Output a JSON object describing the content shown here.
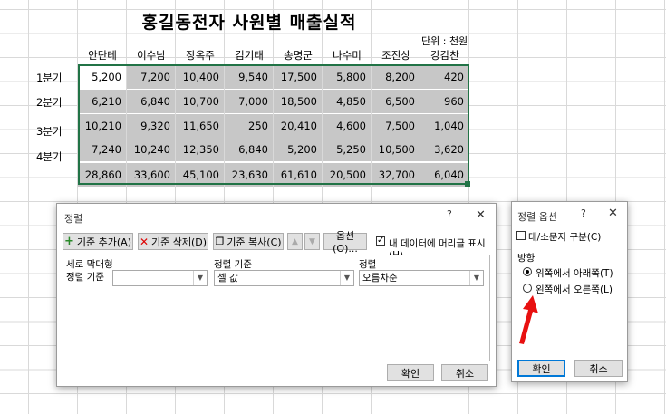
{
  "sheet": {
    "title": "홍길동전자 사원별 매출실적",
    "unit": "단위 : 천원",
    "columns": [
      "안단테",
      "이수남",
      "장옥주",
      "김기태",
      "송명군",
      "나수미",
      "조진상",
      "강감찬"
    ],
    "rows": [
      {
        "label": "1분기",
        "values": [
          "5,200",
          "7,200",
          "10,400",
          "9,540",
          "17,500",
          "5,800",
          "8,200",
          "420"
        ]
      },
      {
        "label": "2분기",
        "values": [
          "6,210",
          "6,840",
          "10,700",
          "7,000",
          "18,500",
          "4,850",
          "6,500",
          "960"
        ]
      },
      {
        "label": "3분기",
        "values": [
          "10,210",
          "9,320",
          "11,650",
          "250",
          "20,410",
          "4,600",
          "7,500",
          "1,040"
        ]
      },
      {
        "label": "4분기",
        "values": [
          "7,240",
          "10,240",
          "12,350",
          "6,840",
          "5,200",
          "5,250",
          "10,500",
          "3,620"
        ]
      },
      {
        "label": "",
        "values": [
          "28,860",
          "33,600",
          "45,100",
          "23,630",
          "61,610",
          "20,500",
          "32,700",
          "6,040"
        ]
      }
    ]
  },
  "sort_dialog": {
    "title": "정렬",
    "help": "?",
    "close": "✕",
    "add_level": "기준 추가(A)",
    "delete_level": "기준 삭제(D)",
    "copy_level": "기준 복사(C)",
    "options": "옵션(O)...",
    "header_checkbox": "내 데이터에 머리글 표시(H)",
    "header_col_label": "세로 막대형",
    "sort_on_label": "정렬 기준",
    "order_label": "정렬",
    "row_label": "정렬 기준",
    "column_value": "",
    "sort_on_value": "셀 값",
    "order_value": "오름차순",
    "ok": "확인",
    "cancel": "취소"
  },
  "options_dialog": {
    "title": "정렬 옵션",
    "help": "?",
    "close": "✕",
    "case_sensitive": "대/소문자 구분(C)",
    "orientation_label": "방향",
    "top_to_bottom": "위쪽에서 아래쪽(T)",
    "left_to_right": "왼쪽에서 오른쪽(L)",
    "ok": "확인",
    "cancel": "취소"
  },
  "colors": {
    "accent": "#217346",
    "arrow": "#e81010",
    "shade": "#c7c7c7",
    "focus": "#0078d7"
  }
}
